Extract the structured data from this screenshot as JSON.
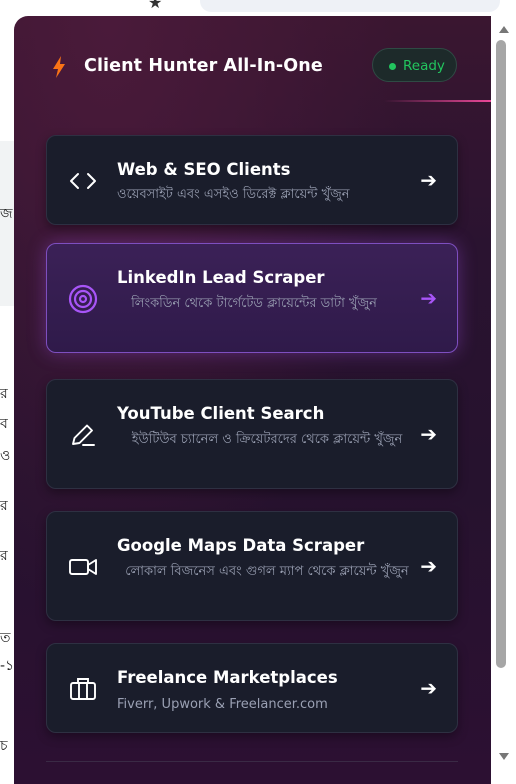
{
  "browser": {
    "star_icon": "star-icon",
    "extensions": [
      {
        "name": "ext-1-icon",
        "color": "#4f7ff0"
      },
      {
        "name": "ext-2-icon",
        "color": "#2563eb"
      },
      {
        "name": "ext-3-icon",
        "color": "#e0245e"
      },
      {
        "name": "ext-4-icon",
        "color": "#1e90ff"
      },
      {
        "name": "ext-5-icon",
        "color": "#666666"
      },
      {
        "name": "ext-6-icon",
        "color": "#1f2b3a"
      },
      {
        "name": "ext-7-icon",
        "color": "#c2185b"
      }
    ]
  },
  "underlying_page": {
    "fragments": [
      "জ",
      "র",
      "ব",
      "ও",
      "র",
      "র",
      "ত",
      "-১",
      "চ"
    ]
  },
  "popup": {
    "title": "Client Hunter All-In-One",
    "status": "Ready",
    "colors": {
      "accent": "#a855f7",
      "status_green": "#22c55e",
      "bolt": "#f97316",
      "header_line": "#ec4899"
    },
    "cards": [
      {
        "title": "Web & SEO Clients",
        "desc": "ওয়েবসাইট এবং এসইও ডিরেক্ট ক্লায়েন্ট খুঁজুন",
        "icon": "code-icon",
        "arrow": "➔",
        "active": false
      },
      {
        "title": "LinkedIn Lead Scraper",
        "desc": "লিংকডিন থেকে টার্গেটেড ক্লায়েন্টের ডাটা খুঁজুন",
        "icon": "target-icon",
        "arrow": "➔",
        "active": true
      },
      {
        "title": "YouTube Client Search",
        "desc": "ইউটিউব চ্যানেল ও ক্রিয়েটরদের থেকে ক্লায়েন্ট খুঁজুন",
        "icon": "pen-icon",
        "arrow": "➔",
        "active": false
      },
      {
        "title": "Google Maps Data Scraper",
        "desc": "লোকাল বিজনেস এবং গুগল ম্যাপ থেকে ক্লায়েন্ট খুঁজুন",
        "icon": "video-camera-icon",
        "arrow": "➔",
        "active": false
      },
      {
        "title": "Freelance Marketplaces",
        "desc": "Fiverr, Upwork & Freelancer.com",
        "icon": "briefcase-icon",
        "arrow": "➔",
        "active": false
      }
    ]
  }
}
